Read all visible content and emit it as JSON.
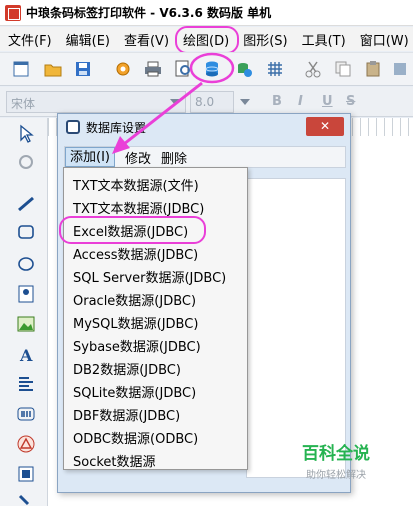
{
  "app": {
    "title": "中琅条码标签打印软件 - V6.3.6 数码版 单机"
  },
  "menubar": {
    "items": [
      "文件(F)",
      "编辑(E)",
      "查看(V)",
      "绘图(D)",
      "图形(S)",
      "工具(T)",
      "窗口(W)"
    ]
  },
  "toolbar2": {
    "font_name": "宋体",
    "font_size": "8.0",
    "format_buttons": [
      "B",
      "I",
      "U",
      "S"
    ]
  },
  "dialog": {
    "title": "数据库设置",
    "close_label": "✕",
    "menu": {
      "add": "添加(I)",
      "edit": "修改",
      "delete": "删除"
    },
    "add_menu_items": [
      "TXT文本数据源(文件)",
      "TXT文本数据源(JDBC)",
      "Excel数据源(JDBC)",
      "Access数据源(JDBC)",
      "SQL Server数据源(JDBC)",
      "Oracle数据源(JDBC)",
      "MySQL数据源(JDBC)",
      "Sybase数据源(JDBC)",
      "DB2数据源(JDBC)",
      "SQLite数据源(JDBC)",
      "DBF数据源(JDBC)",
      "ODBC数据源(ODBC)",
      "Socket数据源"
    ]
  },
  "watermark": {
    "title": "百科全说",
    "subtitle": "助你轻松解决"
  },
  "colors": {
    "highlight": "#ea3fd8",
    "watermark": "#26b351"
  }
}
